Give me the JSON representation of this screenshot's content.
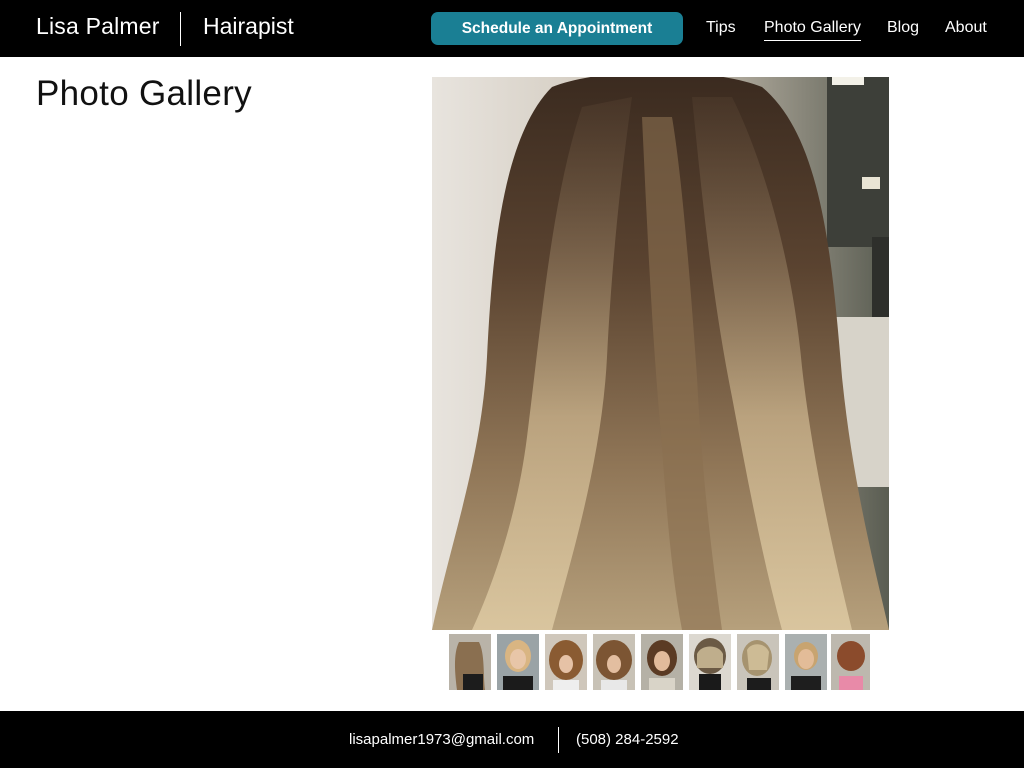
{
  "header": {
    "brand_name": "Lisa Palmer",
    "brand_tagline": "Hairapist",
    "cta_label": "Schedule an Appointment",
    "nav": [
      {
        "label": "Tips",
        "active": false
      },
      {
        "label": "Photo Gallery",
        "active": true
      },
      {
        "label": "Blog",
        "active": false
      },
      {
        "label": "About",
        "active": false
      }
    ]
  },
  "main": {
    "title": "Photo Gallery",
    "featured_photo": "long-balayage-hair-back-view",
    "thumbnails": [
      "side-profile-long-hair",
      "blonde-smiling-woman",
      "curly-brown-bob",
      "wavy-brunette-bob",
      "brunette-shoulder-cut",
      "short-bob-back-view",
      "highlighted-bob-side",
      "short-blonde-smiling",
      "red-bob-back-view"
    ]
  },
  "footer": {
    "email": "lisapalmer1973@gmail.com",
    "phone": "(508) 284-2592"
  },
  "colors": {
    "header_bg": "#000000",
    "cta_bg": "#1a7f94",
    "footer_bg": "#000000"
  }
}
